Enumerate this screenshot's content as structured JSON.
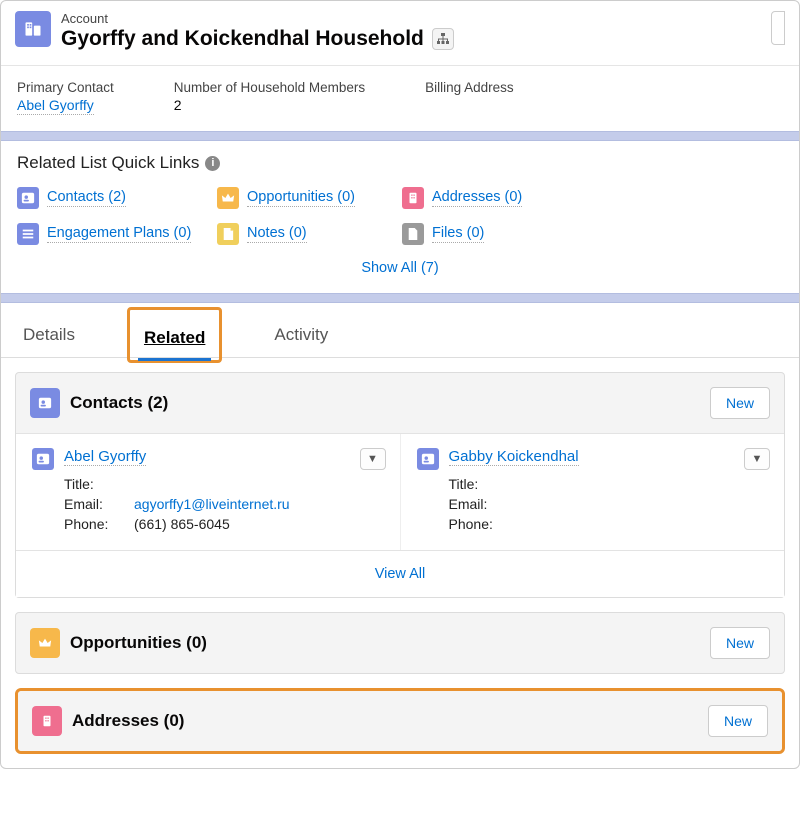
{
  "header": {
    "object_label": "Account",
    "name": "Gyorffy and Koickendhal Household"
  },
  "highlights": [
    {
      "label": "Primary Contact",
      "value": "Abel Gyorffy",
      "link": true
    },
    {
      "label": "Number of Household Members",
      "value": "2",
      "link": false
    },
    {
      "label": "Billing Address",
      "value": "",
      "link": false
    }
  ],
  "quick_links": {
    "title": "Related List Quick Links",
    "items": [
      {
        "icon": "contact",
        "color": "purple",
        "label": "Contacts (2)"
      },
      {
        "icon": "crown",
        "color": "orange",
        "label": "Opportunities (0)"
      },
      {
        "icon": "building",
        "color": "pink",
        "label": "Addresses (0)"
      },
      {
        "icon": "plan",
        "color": "purple",
        "label": "Engagement Plans (0)"
      },
      {
        "icon": "note",
        "color": "yellow",
        "label": "Notes (0)"
      },
      {
        "icon": "file",
        "color": "grey",
        "label": "Files (0)"
      }
    ],
    "show_all": "Show All (7)"
  },
  "tabs": {
    "details": "Details",
    "related": "Related",
    "activity": "Activity"
  },
  "related": {
    "contacts": {
      "title": "Contacts (2)",
      "new_label": "New",
      "view_all": "View All",
      "items": [
        {
          "name": "Abel Gyorffy",
          "title_label": "Title:",
          "title_val": "",
          "email_label": "Email:",
          "email_val": "agyorffy1@liveinternet.ru",
          "phone_label": "Phone:",
          "phone_val": "(661) 865-6045"
        },
        {
          "name": "Gabby Koickendhal",
          "title_label": "Title:",
          "title_val": "",
          "email_label": "Email:",
          "email_val": "",
          "phone_label": "Phone:",
          "phone_val": ""
        }
      ]
    },
    "opportunities": {
      "title": "Opportunities (0)",
      "new_label": "New"
    },
    "addresses": {
      "title": "Addresses (0)",
      "new_label": "New"
    }
  }
}
